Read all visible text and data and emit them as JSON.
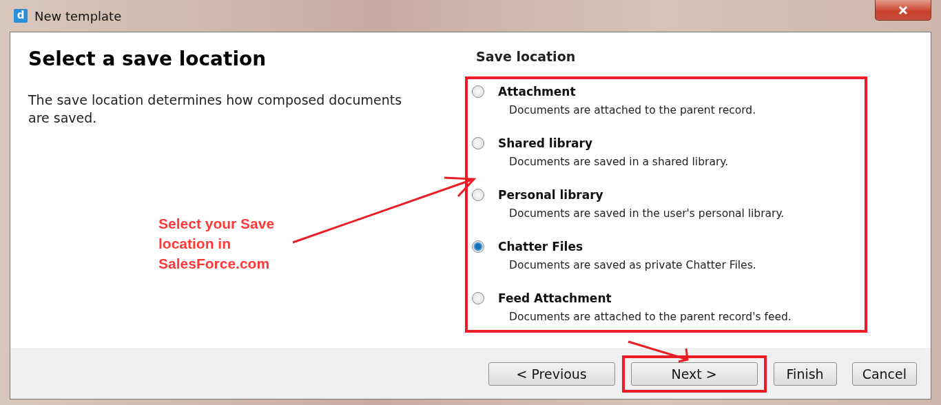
{
  "window": {
    "title": "New template",
    "icon_letter": "d"
  },
  "heading": "Select a save location",
  "description": "The save location determines how composed documents are saved.",
  "section_title": "Save location",
  "options_highlighted": true,
  "options": [
    {
      "label": "Attachment",
      "description": "Documents are attached to the parent record.",
      "selected": false
    },
    {
      "label": "Shared library",
      "description": "Documents are saved in a shared library.",
      "selected": false
    },
    {
      "label": "Personal library",
      "description": "Documents are saved in the user's personal library.",
      "selected": false
    },
    {
      "label": "Chatter Files",
      "description": "Documents are saved as private Chatter Files.",
      "selected": true
    },
    {
      "label": "Feed Attachment",
      "description": "Documents are attached to the parent record's feed.",
      "selected": false
    }
  ],
  "buttons": [
    {
      "label": "< Previous",
      "highlighted": false
    },
    {
      "label": "Next >",
      "highlighted": true
    },
    {
      "label": "Finish",
      "highlighted": false
    },
    {
      "label": "Cancel",
      "highlighted": false
    }
  ],
  "annotation": {
    "lines": [
      "Select your Save",
      "location in",
      "SalesForce.com"
    ]
  }
}
